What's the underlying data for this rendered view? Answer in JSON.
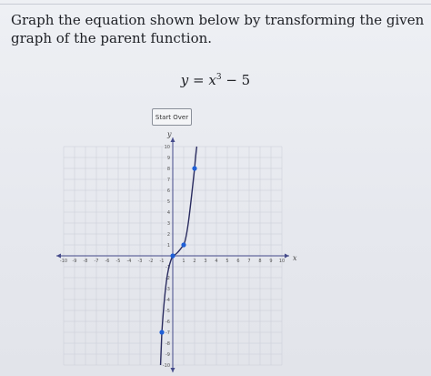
{
  "prompt": {
    "text": "Graph the equation shown below by transforming the given graph of the parent function."
  },
  "equation": {
    "lhs": "y",
    "eq": " = ",
    "base": "x",
    "exponent": "3",
    "rest": " − 5"
  },
  "start_over_label": "Start Over",
  "graph": {
    "x_axis_label": "x",
    "y_axis_label": "y",
    "x_ticks": [
      "-10",
      "-9",
      "-8",
      "-7",
      "-6",
      "-5",
      "-4",
      "-3",
      "-2",
      "-1",
      "1",
      "2",
      "3",
      "4",
      "5",
      "6",
      "7",
      "8",
      "9",
      "10"
    ],
    "y_ticks": [
      "10",
      "9",
      "8",
      "7",
      "6",
      "5",
      "4",
      "3",
      "2",
      "1",
      "-1",
      "-2",
      "-3",
      "-4",
      "-5",
      "-6",
      "-7",
      "-8",
      "-9",
      "-10"
    ],
    "curve_color": "#2a2c60",
    "point_color": "#1f5fd6",
    "points": [
      [
        -1,
        -7
      ],
      [
        0,
        0
      ],
      [
        1,
        1
      ],
      [
        2,
        8
      ]
    ]
  }
}
